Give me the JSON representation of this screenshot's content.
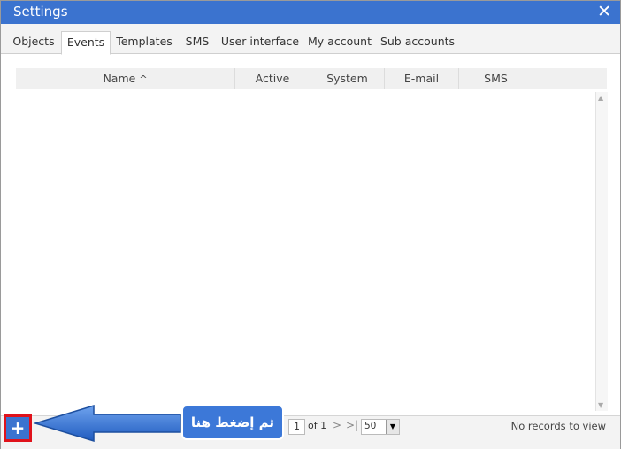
{
  "window": {
    "title": "Settings",
    "close_glyph": "✕"
  },
  "tabs": [
    {
      "label": "Objects",
      "active": false
    },
    {
      "label": "Events",
      "active": true
    },
    {
      "label": "Templates",
      "active": false
    },
    {
      "label": "SMS",
      "active": false
    },
    {
      "label": "User interface",
      "active": false
    },
    {
      "label": "My account",
      "active": false
    },
    {
      "label": "Sub accounts",
      "active": false
    }
  ],
  "grid": {
    "columns": [
      {
        "label": "Name",
        "sorted": "asc"
      },
      {
        "label": "Active"
      },
      {
        "label": "System"
      },
      {
        "label": "E-mail"
      },
      {
        "label": "SMS"
      }
    ],
    "sort_glyph": "^"
  },
  "pager": {
    "add_glyph": "+",
    "page": "1",
    "of_text": "of 1",
    "next_glyph": ">",
    "last_glyph": ">|",
    "rows_per_page": "50",
    "records_text": "No records to view"
  },
  "annotation": {
    "text": "ثم إضغط هنا",
    "arrow_color": "#2f6fd0",
    "box_color": "#3c78d8",
    "highlight_color": "#e0121b"
  },
  "colors": {
    "accent": "#3b73cf"
  }
}
